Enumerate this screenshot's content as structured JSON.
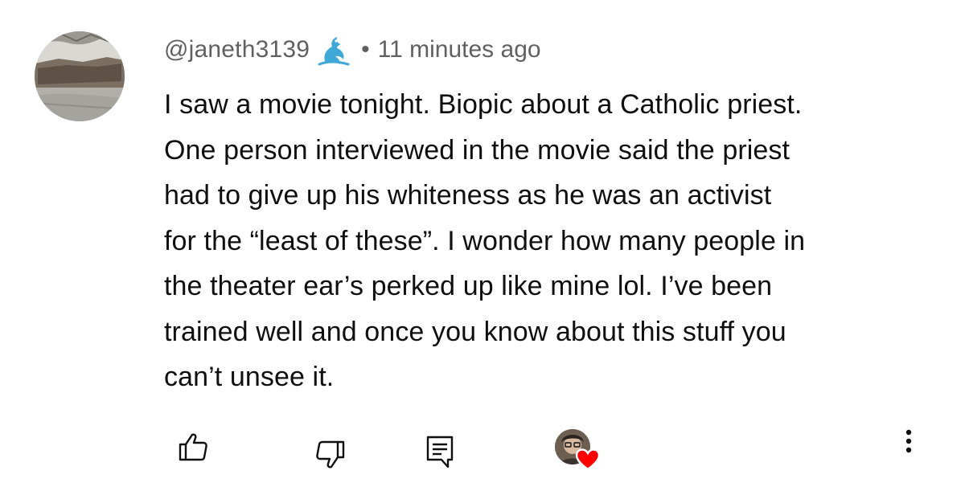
{
  "comment": {
    "author_handle": "@janeth3139",
    "separator": "•",
    "timestamp": "11 minutes ago",
    "text_lines": [
      "I saw a movie tonight. Biopic about a Catholic priest.",
      "One person interviewed in the movie said the priest",
      "had to give up his whiteness as he was an activist",
      "for the “least of these”. I wonder how many people in",
      "the theater ear’s perked up like mine lol. I’ve been",
      "trained well and once you know about this stuff you",
      "can’t unsee it."
    ]
  },
  "icons": {
    "author_avatar": "avatar",
    "author_badge": "bird-badge-icon",
    "like": "thumbs-up-icon",
    "dislike": "thumbs-down-icon",
    "reply": "reply-comment-icon",
    "creator_heart": "creator-heart-icon",
    "more": "vertical-dots-icon"
  },
  "colors": {
    "text_primary": "#0f0f0f",
    "text_secondary": "#606060",
    "badge": "#3fa8d6",
    "heart": "#ff0000"
  }
}
